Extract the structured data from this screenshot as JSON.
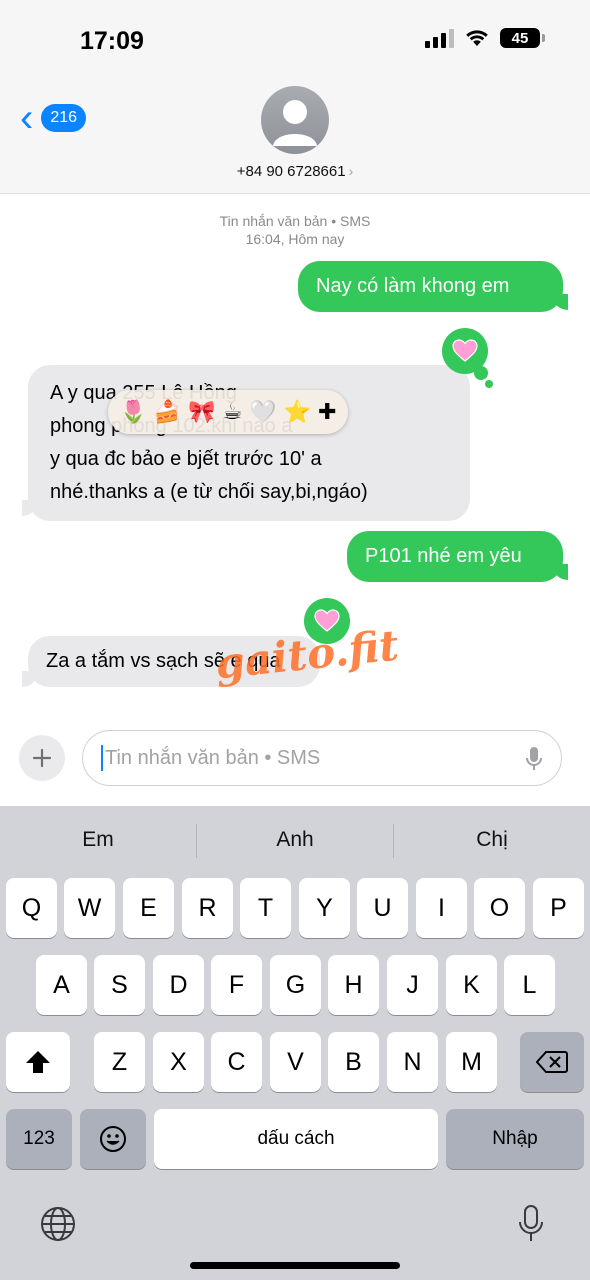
{
  "status_bar": {
    "time": "17:09",
    "battery": "45"
  },
  "header": {
    "back_count": "216",
    "contact_number": "+84 90 6728661"
  },
  "thread": {
    "meta_line1": "Tin nhắn văn bản • SMS",
    "meta_line2": "16:04, Hôm nay",
    "messages": [
      {
        "direction": "outgoing",
        "text": "Nay có làm khong em"
      },
      {
        "direction": "incoming",
        "text": "A y qua 255 Lê Hồng phong phòng 102 khi nào a y qua đc bảo e bjết trước 10' a nhé.thanks a (e từ chối say,bi,ngáo)",
        "lines": [
          "A y qua 255 Lê Hồng",
          "phong phòng 102.khi nào a",
          "y qua đc bảo e bjết trước 10' a",
          "nhé.thanks a (e từ chối say,bi,ngáo)"
        ],
        "reaction": "heart"
      },
      {
        "direction": "outgoing",
        "text": "P101 nhé em yêu"
      },
      {
        "direction": "incoming",
        "text": "Za a tắm vs sạch sẽ e qua",
        "reaction": "heart"
      }
    ],
    "sticker_emojis": [
      "🌷",
      "🍰",
      "🎀",
      "☕",
      "🤍",
      "⭐",
      "✚"
    ],
    "watermark": "gaito.fit"
  },
  "composer": {
    "placeholder": "Tin nhắn văn bản • SMS"
  },
  "keyboard": {
    "suggestions": [
      "Em",
      "Anh",
      "Chị"
    ],
    "row1": [
      "Q",
      "W",
      "E",
      "R",
      "T",
      "Y",
      "U",
      "I",
      "O",
      "P"
    ],
    "row2": [
      "A",
      "S",
      "D",
      "F",
      "G",
      "H",
      "J",
      "K",
      "L"
    ],
    "row3": [
      "Z",
      "X",
      "C",
      "V",
      "B",
      "N",
      "M"
    ],
    "numbers_key": "123",
    "space_key": "dấu cách",
    "return_key": "Nhập"
  },
  "colors": {
    "outgoing_bubble": "#34c759",
    "incoming_bubble": "#e9e9eb",
    "accent": "#0a84ff"
  }
}
